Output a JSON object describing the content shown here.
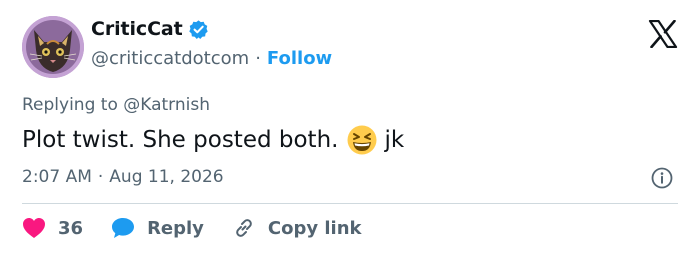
{
  "author": {
    "display_name": "CriticCat",
    "handle": "@criticcatdotcom",
    "separator": "·",
    "follow_label": "Follow",
    "verified": true
  },
  "tweet": {
    "reply_to": "Replying to @Katrnish",
    "text_before": "Plot twist. She posted both.",
    "emoji": "grinning-squinting-face",
    "text_after": "jk",
    "time": "2:07 AM",
    "sep": "·",
    "date": "Aug 11, 2026"
  },
  "actions": {
    "like_count": "36",
    "reply_label": "Reply",
    "copy_label": "Copy link"
  },
  "icons": {
    "platform": "x-logo-icon",
    "verified": "verified-badge-icon",
    "info": "info-icon",
    "like": "heart-icon",
    "reply": "speech-bubble-icon",
    "copy": "link-icon"
  },
  "colors": {
    "accent": "#1d9bf0",
    "heart": "#f91880",
    "secondary_text": "#536471",
    "primary_text": "#0f1419"
  }
}
